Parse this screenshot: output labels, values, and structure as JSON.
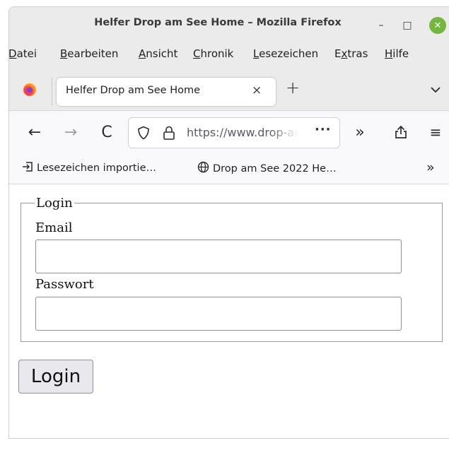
{
  "window": {
    "title": "Helfer Drop am See Home – Mozilla Firefox",
    "controls": {
      "minimize": "–",
      "maximize": "□",
      "close": "✕"
    }
  },
  "menubar": {
    "items": [
      {
        "first": "D",
        "rest": "atei"
      },
      {
        "first": "B",
        "rest": "earbeiten"
      },
      {
        "first": "A",
        "rest": "nsicht"
      },
      {
        "first": "C",
        "rest": "hronik"
      },
      {
        "first": "L",
        "rest": "esezeichen"
      },
      {
        "pre": "E",
        "first": "x",
        "rest": "tras"
      },
      {
        "first": "H",
        "rest": "ilfe"
      }
    ]
  },
  "tabs": {
    "active_label": "Helfer Drop am See Home",
    "close_glyph": "×",
    "new_tab_glyph": "+"
  },
  "navigation": {
    "back_glyph": "←",
    "forward_glyph": "→",
    "reload_glyph": "C",
    "url": "https://www.drop-am",
    "page_actions_glyph": "···",
    "overflow_glyph": "»",
    "menu_glyph": "≡"
  },
  "bookmarks": {
    "import_label": "Lesezeichen importie…",
    "site_label": "Drop am See 2022 He…",
    "overflow_glyph": "»"
  },
  "page": {
    "legend": "Login",
    "email_label": "Email",
    "email_value": "",
    "password_label": "Passwort",
    "password_value": "",
    "login_button": "Login"
  },
  "colors": {
    "chrome_background": "#ebebeb",
    "toolbar_background": "#f9f9fb",
    "close_button": "#73b83d"
  },
  "icons": [
    "firefox-logo",
    "shield-icon",
    "lock-icon",
    "share-icon",
    "import-icon",
    "globe-icon",
    "chevron-down-icon"
  ]
}
